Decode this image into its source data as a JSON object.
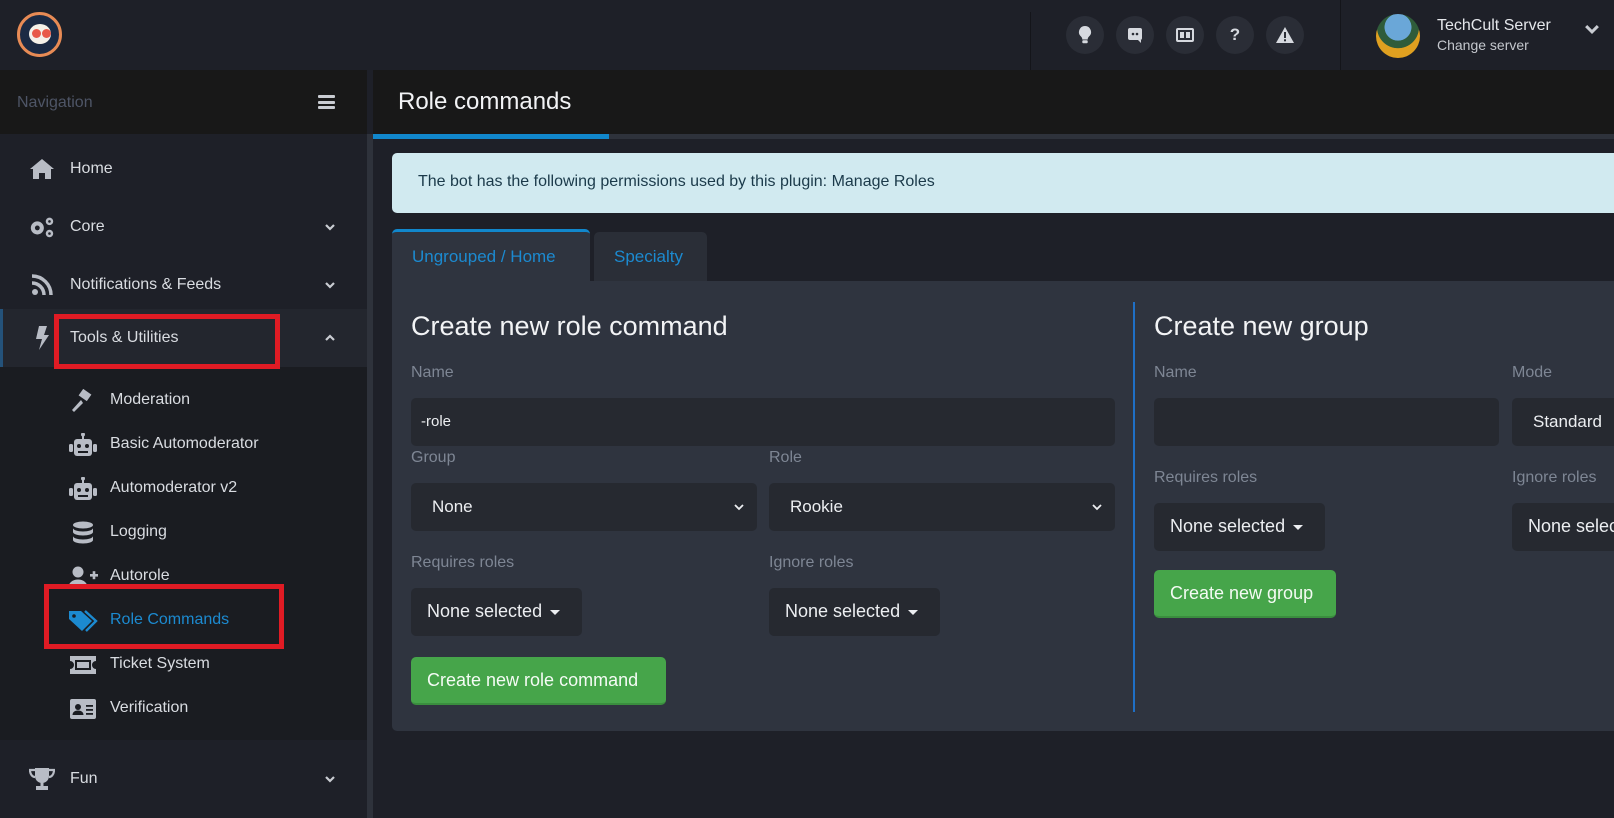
{
  "header": {
    "logo_alt": "bot-logo",
    "icons": [
      {
        "name": "lightbulb-icon",
        "glyph": "💡"
      },
      {
        "name": "discord-icon",
        "glyph": "◙"
      },
      {
        "name": "news-icon",
        "glyph": "▤"
      },
      {
        "name": "help-icon",
        "glyph": "?"
      },
      {
        "name": "warning-icon",
        "glyph": "⚠"
      }
    ],
    "server": {
      "name": "TechCult Server",
      "subtitle": "Change server"
    }
  },
  "sidebar": {
    "title": "Navigation",
    "items": [
      {
        "label": "Home",
        "icon": "home-icon",
        "expandable": false
      },
      {
        "label": "Core",
        "icon": "cogs-icon",
        "expandable": true
      },
      {
        "label": "Notifications & Feeds",
        "icon": "rss-icon",
        "expandable": true
      },
      {
        "label": "Tools & Utilities",
        "icon": "bolt-icon",
        "expandable": true,
        "expanded": true
      },
      {
        "label": "Fun",
        "icon": "trophy-icon",
        "expandable": true
      }
    ],
    "subitems": [
      {
        "label": "Moderation",
        "icon": "gavel-icon"
      },
      {
        "label": "Basic Automoderator",
        "icon": "robot-icon"
      },
      {
        "label": "Automoderator v2",
        "icon": "robot-icon"
      },
      {
        "label": "Logging",
        "icon": "database-icon"
      },
      {
        "label": "Autorole",
        "icon": "user-plus-icon"
      },
      {
        "label": "Role Commands",
        "icon": "tags-icon",
        "active": true
      },
      {
        "label": "Ticket System",
        "icon": "ticket-icon"
      },
      {
        "label": "Verification",
        "icon": "id-card-icon"
      }
    ]
  },
  "page": {
    "title": "Role commands",
    "progress_percent": 19,
    "alert": "The bot has the following permissions used by this plugin: Manage Roles",
    "tabs": [
      {
        "label": "Ungrouped / Home",
        "active": true
      },
      {
        "label": "Specialty",
        "active": false
      }
    ]
  },
  "role_command_form": {
    "heading": "Create new role command",
    "name_label": "Name",
    "name_value": "-role",
    "group_label": "Group",
    "group_value": "None",
    "role_label": "Role",
    "role_value": "Rookie",
    "requires_label": "Requires roles",
    "requires_value": "None selected",
    "ignore_label": "Ignore roles",
    "ignore_value": "None selected",
    "submit_label": "Create new role command"
  },
  "group_form": {
    "heading": "Create new group",
    "name_label": "Name",
    "name_value": "",
    "mode_label": "Mode",
    "mode_value": "Standard",
    "requires_label": "Requires roles",
    "requires_value": "None selected",
    "ignore_label": "Ignore roles",
    "ignore_value": "None selected",
    "submit_label": "Create new group"
  },
  "colors": {
    "accent": "#1187cc",
    "success": "#46a54a",
    "highlight_box": "#e01b24",
    "alert_bg": "#d1eaf0"
  }
}
